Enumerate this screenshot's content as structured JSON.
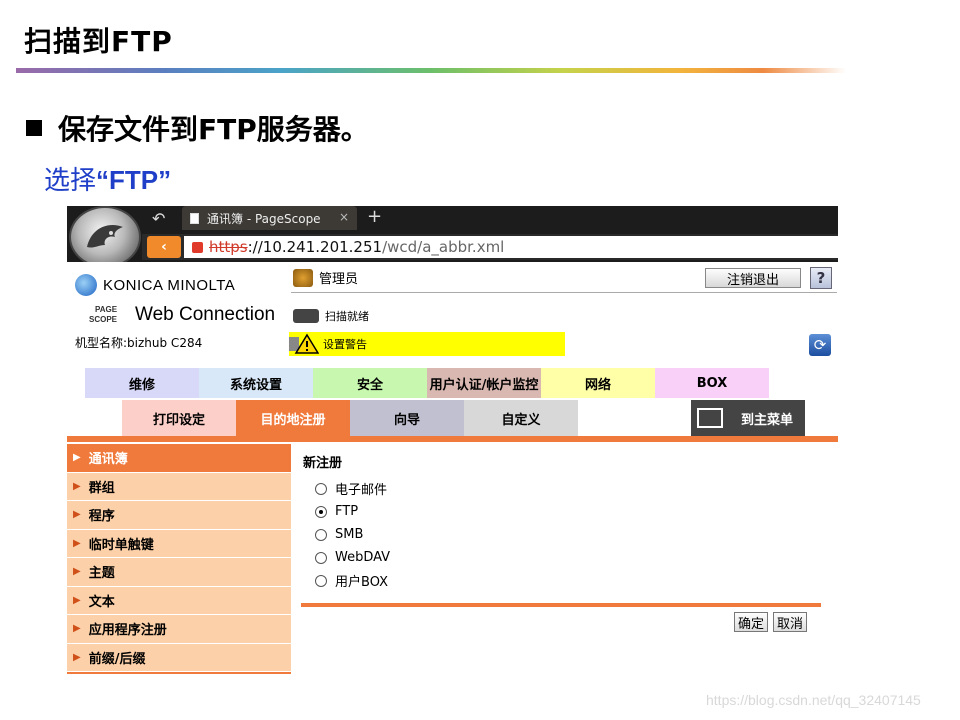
{
  "slide": {
    "title": "扫描到FTP",
    "bullet": "保存文件到FTP服务器。",
    "sub_prefix": "选择",
    "sub_bold": "“FTP”"
  },
  "browser": {
    "tab_title": "通讯簿 - PageScope",
    "tab_close": "×",
    "new_tab": "+",
    "url_scheme": "https",
    "url_host": "://10.241.201.251",
    "url_path": "/wcd/a_abbr.xml"
  },
  "header": {
    "brand": "KONICA MINOLTA",
    "pagescope_mark_top": "PAGE",
    "pagescope_mark_bottom": "SCOPE",
    "product": "Web Connection",
    "model": "机型名称:bizhub C284",
    "admin": "管理员",
    "logout": "注销退出",
    "help": "?",
    "scan_status": "扫描就绪",
    "warning": "设置警告"
  },
  "main_tabs": [
    {
      "label": "维修",
      "color": "#d8d8f8"
    },
    {
      "label": "系统设置",
      "color": "#d8e8f8"
    },
    {
      "label": "安全",
      "color": "#c8f8b0"
    },
    {
      "label": "用户认证/帐户监控",
      "color": "#d8b8b0"
    },
    {
      "label": "网络",
      "color": "#ffffa8"
    },
    {
      "label": "BOX",
      "color": "#f8d0f8"
    }
  ],
  "sub_tabs": [
    {
      "label": "打印设定",
      "color": "#fcd0c8",
      "text": "#000"
    },
    {
      "label": "目的地注册",
      "color": "#f07a3c",
      "text": "#fff"
    },
    {
      "label": "向导",
      "color": "#c0c0d0",
      "text": "#000"
    },
    {
      "label": "自定义",
      "color": "#d8d8d8",
      "text": "#000"
    }
  ],
  "home": "到主菜单",
  "sidebar": [
    {
      "label": "通讯簿",
      "active": true
    },
    {
      "label": "群组",
      "active": false
    },
    {
      "label": "程序",
      "active": false
    },
    {
      "label": "临时单触键",
      "active": false
    },
    {
      "label": "主题",
      "active": false
    },
    {
      "label": "文本",
      "active": false
    },
    {
      "label": "应用程序注册",
      "active": false
    },
    {
      "label": "前缀/后缀",
      "active": false
    }
  ],
  "content": {
    "heading": "新注册",
    "options": [
      {
        "label": "电子邮件",
        "selected": false
      },
      {
        "label": "FTP",
        "selected": true
      },
      {
        "label": "SMB",
        "selected": false
      },
      {
        "label": "WebDAV",
        "selected": false
      },
      {
        "label": "用户BOX",
        "selected": false
      }
    ],
    "ok": "确定",
    "cancel": "取消"
  },
  "watermark": "https://blog.csdn.net/qq_32407145"
}
